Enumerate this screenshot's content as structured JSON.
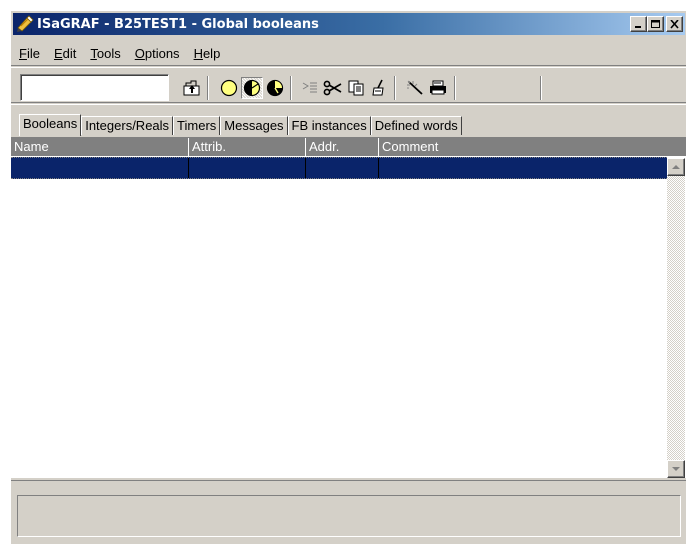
{
  "window": {
    "title": "ISaGRAF - B25TEST1 - Global booleans",
    "minimize_label": "minimize",
    "maximize_label": "maximize",
    "close_label": "close"
  },
  "menu": {
    "items": [
      {
        "accel": "F",
        "rest": "ile"
      },
      {
        "accel": "E",
        "rest": "dit"
      },
      {
        "accel": "T",
        "rest": "ools"
      },
      {
        "accel": "O",
        "rest": "ptions"
      },
      {
        "accel": "H",
        "rest": "elp"
      }
    ]
  },
  "toolbar": {
    "name_value": "",
    "icons": [
      "open-folder-icon",
      "circle-empty-icon",
      "circle-half-icon",
      "circle-quarter-icon",
      "insert-row-icon",
      "cut-icon",
      "copy-icon",
      "paste-icon",
      "wizard-icon",
      "print-icon"
    ]
  },
  "tabs": [
    "Booleans",
    "Integers/Reals",
    "Timers",
    "Messages",
    "FB instances",
    "Defined words"
  ],
  "active_tab": "Booleans",
  "grid": {
    "columns": [
      "Name",
      "Attrib.",
      "Addr.",
      "Comment"
    ],
    "rows": [
      {
        "name": "",
        "attrib": "",
        "addr": "",
        "comment": "",
        "selected": true
      }
    ]
  },
  "colors": {
    "face": "#d4d0c8",
    "title_start": "#0a246a",
    "title_end": "#a6caf0",
    "selection": "#0a246a",
    "header": "#808080"
  }
}
